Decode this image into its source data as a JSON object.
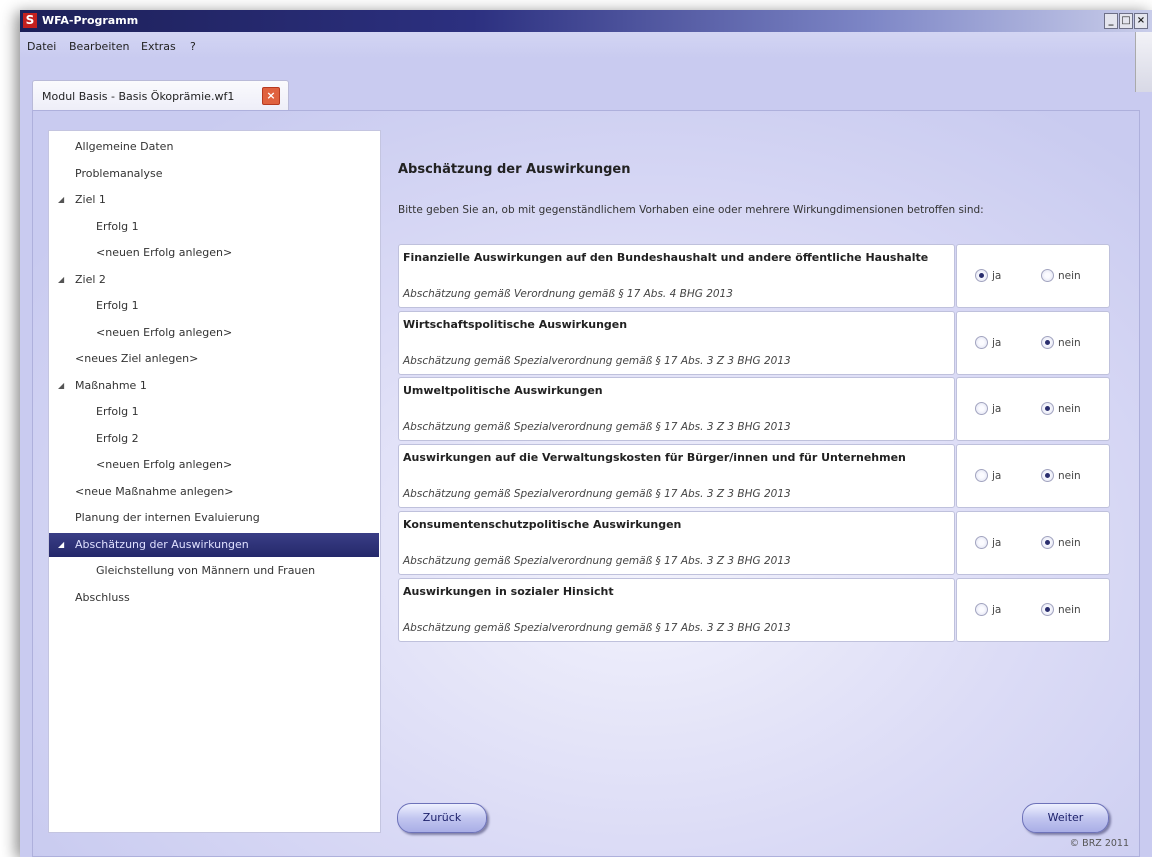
{
  "window": {
    "title": "WFA-Programm",
    "app_icon": "S"
  },
  "menu": [
    "Datei",
    "Bearbeiten",
    "Extras",
    "?"
  ],
  "tab": {
    "label": "Modul Basis - Basis Ökoprämie.wf1"
  },
  "tree": [
    {
      "label": "Allgemeine Daten",
      "level": 0,
      "expander": false,
      "selected": false
    },
    {
      "label": "Problemanalyse",
      "level": 0,
      "expander": false,
      "selected": false
    },
    {
      "label": "Ziel 1",
      "level": 0,
      "expander": true,
      "selected": false
    },
    {
      "label": "Erfolg 1",
      "level": 1,
      "expander": false,
      "selected": false
    },
    {
      "label": "<neuen Erfolg anlegen>",
      "level": 1,
      "expander": false,
      "selected": false
    },
    {
      "label": "Ziel 2",
      "level": 0,
      "expander": true,
      "selected": false
    },
    {
      "label": "Erfolg 1",
      "level": 1,
      "expander": false,
      "selected": false
    },
    {
      "label": "<neuen Erfolg anlegen>",
      "level": 1,
      "expander": false,
      "selected": false
    },
    {
      "label": "<neues Ziel anlegen>",
      "level": 0,
      "expander": false,
      "selected": false
    },
    {
      "label": "Maßnahme 1",
      "level": 0,
      "expander": true,
      "selected": false
    },
    {
      "label": "Erfolg 1",
      "level": 1,
      "expander": false,
      "selected": false
    },
    {
      "label": "Erfolg 2",
      "level": 1,
      "expander": false,
      "selected": false
    },
    {
      "label": "<neuen Erfolg anlegen>",
      "level": 1,
      "expander": false,
      "selected": false
    },
    {
      "label": "<neue Maßnahme anlegen>",
      "level": 0,
      "expander": false,
      "selected": false
    },
    {
      "label": "Planung der internen Evaluierung",
      "level": 0,
      "expander": false,
      "selected": false
    },
    {
      "label": "Abschätzung der Auswirkungen",
      "level": 0,
      "expander": true,
      "selected": true
    },
    {
      "label": "Gleichstellung von Männern und Frauen",
      "level": 1,
      "expander": false,
      "selected": false
    },
    {
      "label": "Abschluss",
      "level": 0,
      "expander": false,
      "selected": false
    }
  ],
  "main": {
    "heading": "Abschätzung der Auswirkungen",
    "instruction": "Bitte geben Sie an, ob mit gegenständlichem Vorhaben eine oder mehrere Wirkungdimensionen betroffen sind:",
    "yes_label": "ja",
    "no_label": "nein",
    "rows": [
      {
        "title": "Finanzielle Auswirkungen auf den Bundeshaushalt und andere öffentliche Haushalte",
        "subtitle": "Abschätzung gemäß Verordnung gemäß § 17 Abs. 4 BHG 2013",
        "selected": "ja"
      },
      {
        "title": "Wirtschaftspolitische Auswirkungen",
        "subtitle": "Abschätzung gemäß Spezialverordnung gemäß § 17 Abs. 3 Z 3 BHG 2013",
        "selected": "nein"
      },
      {
        "title": "Umweltpolitische Auswirkungen",
        "subtitle": "Abschätzung gemäß Spezialverordnung gemäß § 17 Abs. 3 Z 3 BHG 2013",
        "selected": "nein"
      },
      {
        "title": "Auswirkungen auf die Verwaltungskosten für Bürger/innen und für Unternehmen",
        "subtitle": "Abschätzung gemäß Spezialverordnung gemäß § 17 Abs. 3 Z 3 BHG 2013",
        "selected": "nein"
      },
      {
        "title": "Konsumentenschutzpolitische Auswirkungen",
        "subtitle": "Abschätzung gemäß Spezialverordnung gemäß § 17 Abs. 3 Z 3 BHG 2013",
        "selected": "nein"
      },
      {
        "title": "Auswirkungen in sozialer Hinsicht",
        "subtitle": "Abschätzung gemäß Spezialverordnung gemäß § 17 Abs. 3 Z 3 BHG 2013",
        "selected": "nein"
      }
    ]
  },
  "buttons": {
    "back": "Zurück",
    "next": "Weiter"
  },
  "footer": {
    "copyright": "© BRZ 2011"
  },
  "colors": {
    "titlebar": "#1d2058",
    "selection": "#2c3070",
    "background": "#c9cbf0",
    "close_tab": "#e0623f"
  }
}
